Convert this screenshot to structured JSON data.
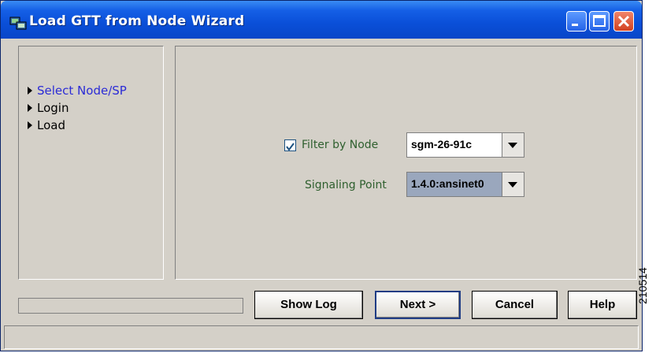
{
  "window": {
    "title": "Load GTT from Node Wizard",
    "titlebar_color": "#0a4fd8",
    "controls": [
      "minimize-icon",
      "maximize-icon",
      "close-icon"
    ]
  },
  "sidebar": {
    "steps": [
      {
        "label": "Select Node/SP",
        "active": true
      },
      {
        "label": "Login",
        "active": false
      },
      {
        "label": "Load",
        "active": false
      }
    ],
    "active_color": "#2b2bd6"
  },
  "main": {
    "filter_by_node": {
      "label": "Filter by Node",
      "checked": true,
      "value": "sgm-26-91c"
    },
    "signaling_point": {
      "label": "Signaling Point",
      "value": "1.4.0:ansinet0"
    }
  },
  "footer": {
    "progress": 0,
    "buttons": {
      "show_log": "Show Log",
      "next": "Next >",
      "cancel": "Cancel",
      "help": "Help"
    },
    "status_text": ""
  },
  "figure_id": "210514"
}
